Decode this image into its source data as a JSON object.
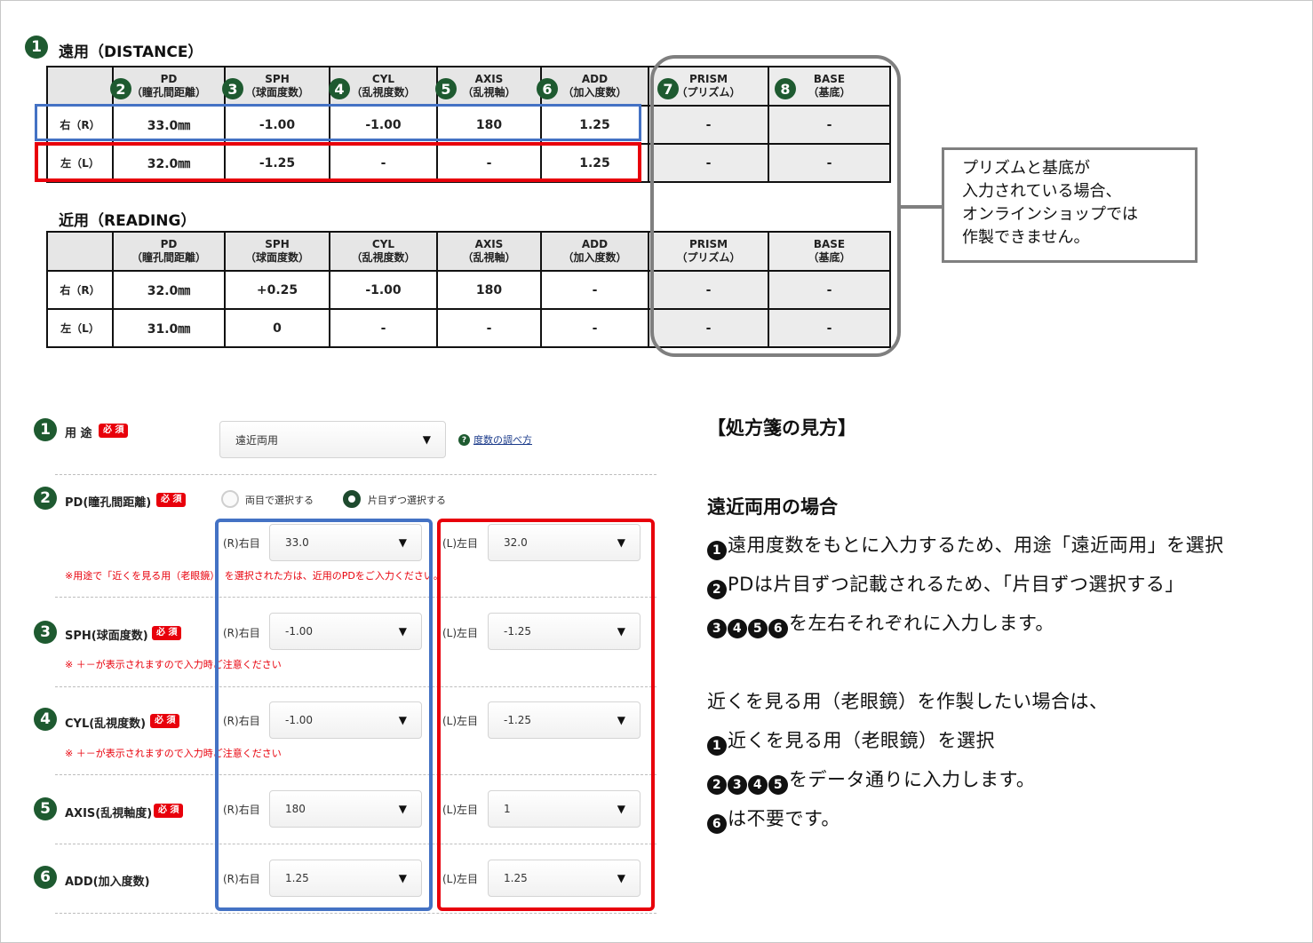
{
  "distance": {
    "num": "1",
    "title": "遠用（DISTANCE）",
    "headers": [
      {
        "num": "",
        "l1": "",
        "l2": ""
      },
      {
        "num": "2",
        "l1": "PD",
        "l2": "（瞳孔間距離）"
      },
      {
        "num": "3",
        "l1": "SPH",
        "l2": "（球面度数）"
      },
      {
        "num": "4",
        "l1": "CYL",
        "l2": "（乱視度数）"
      },
      {
        "num": "5",
        "l1": "AXIS",
        "l2": "（乱視軸）"
      },
      {
        "num": "6",
        "l1": "ADD",
        "l2": "（加入度数）"
      },
      {
        "num": "7",
        "l1": "PRISM",
        "l2": "（プリズム）"
      },
      {
        "num": "8",
        "l1": "BASE",
        "l2": "（基底）"
      }
    ],
    "rows": [
      [
        "右（R）",
        "33.0㎜",
        "-1.00",
        "-1.00",
        "180",
        "1.25",
        "-",
        "-"
      ],
      [
        "左（L）",
        "32.0㎜",
        "-1.25",
        "-",
        "-",
        "1.25",
        "-",
        "-"
      ]
    ]
  },
  "reading": {
    "title": "近用（READING）",
    "headers": [
      {
        "l1": "",
        "l2": ""
      },
      {
        "l1": "PD",
        "l2": "（瞳孔間距離）"
      },
      {
        "l1": "SPH",
        "l2": "（球面度数）"
      },
      {
        "l1": "CYL",
        "l2": "（乱視度数）"
      },
      {
        "l1": "AXIS",
        "l2": "（乱視軸）"
      },
      {
        "l1": "ADD",
        "l2": "（加入度数）"
      },
      {
        "l1": "PRISM",
        "l2": "（プリズム）"
      },
      {
        "l1": "BASE",
        "l2": "（基底）"
      }
    ],
    "rows": [
      [
        "右（R）",
        "32.0㎜",
        "+0.25",
        "-1.00",
        "180",
        "-",
        "-",
        "-"
      ],
      [
        "左（L）",
        "31.0㎜",
        "0",
        "-",
        "-",
        "-",
        "-",
        "-"
      ]
    ]
  },
  "note": {
    "lines": [
      "プリズムと基底が",
      "入力されている場合、",
      "オンラインショップでは",
      "作製できません。"
    ]
  },
  "form": {
    "required": "必 須",
    "usage": {
      "num": "1",
      "label": "用 途",
      "value": "遠近両用",
      "help_icon": "?",
      "help_link": "度数の調べ方"
    },
    "pd": {
      "num": "2",
      "label": "PD(瞳孔間距離)",
      "radio_both": "両目で選択する",
      "radio_each": "片目ずつ選択する",
      "right_label": "(R)右目",
      "right_value": "33.0",
      "left_label": "(L)左目",
      "left_value": "32.0",
      "warning": "※用途で「近くを見る用（老眼鏡）」を選択された方は、近用のPDをご入力ください。"
    },
    "sph": {
      "num": "3",
      "label": "SPH(球面度数)",
      "right_label": "(R)右目",
      "right_value": "-1.00",
      "left_label": "(L)左目",
      "left_value": "-1.25",
      "warning": "※ ＋－が表示されますので入力時ご注意ください"
    },
    "cyl": {
      "num": "4",
      "label": "CYL(乱視度数)",
      "right_label": "(R)右目",
      "right_value": "-1.00",
      "left_label": "(L)左目",
      "left_value": "-1.25",
      "warning": "※ ＋－が表示されますので入力時ご注意ください"
    },
    "axis": {
      "num": "5",
      "label": "AXIS(乱視軸度)",
      "right_label": "(R)右目",
      "right_value": "180",
      "left_label": "(L)左目",
      "left_value": "1"
    },
    "add": {
      "num": "6",
      "label": "ADD(加入度数)",
      "right_label": "(R)右目",
      "right_value": "1.25",
      "left_label": "(L)左目",
      "left_value": "1.25"
    }
  },
  "explain": {
    "title": "【処方箋の見方】",
    "subtitle": "遠近両用の場合",
    "l1_nums": [
      "1"
    ],
    "l1_text": "遠用度数をもとに入力するため、用途「遠近両用」を選択",
    "l2_nums": [
      "2"
    ],
    "l2_text": "PDは片目ずつ記載されるため、「片目ずつ選択する」",
    "l3_nums": [
      "3",
      "4",
      "5",
      "6"
    ],
    "l3_text": "を左右それぞれに入力します。",
    "l4_text": "近くを見る用（老眼鏡）を作製したい場合は、",
    "l5_nums": [
      "1"
    ],
    "l5_text": "近くを見る用（老眼鏡）を選択",
    "l6_nums": [
      "2",
      "3",
      "4",
      "5"
    ],
    "l6_text": "をデータ通りに入力します。",
    "l7_nums": [
      "6"
    ],
    "l7_text": "は不要です。"
  },
  "colors": {
    "green": "#1e5a30",
    "red": "#e8000b",
    "blue": "#4472c4",
    "gray": "#7f7f7f"
  }
}
